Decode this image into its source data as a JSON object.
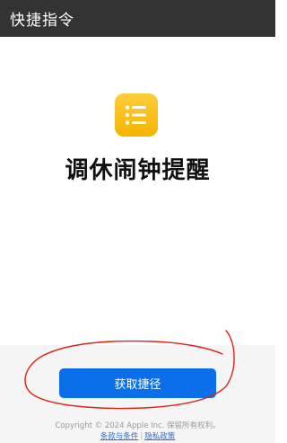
{
  "window": {
    "title": "快捷指令"
  },
  "shortcut": {
    "icon": "list-icon",
    "icon_color": "#f7bd1a",
    "name": "调休闹钟提醒"
  },
  "action": {
    "get_label": "获取捷径",
    "button_color": "#0a6fe8"
  },
  "footer": {
    "copyright": "Copyright © 2024 Apple Inc. 保留所有权利。",
    "terms_label": "条款与条件",
    "privacy_label": "隐私政策"
  },
  "annotation": {
    "stroke_color": "#e0221a"
  }
}
